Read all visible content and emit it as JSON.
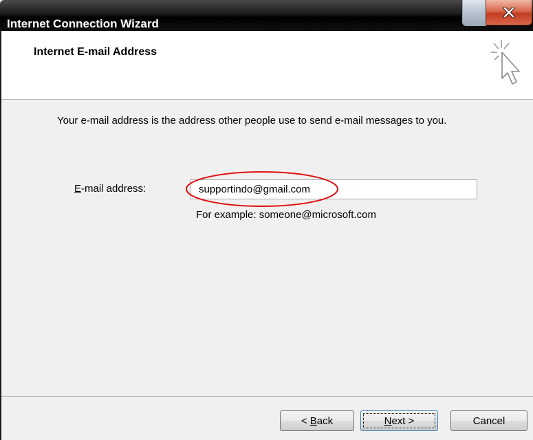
{
  "window": {
    "title": "Internet Connection Wizard"
  },
  "header": {
    "title": "Internet E-mail Address",
    "icon": "wizard-cursor-icon"
  },
  "body": {
    "description": "Your e-mail address is the address other people use to send e-mail messages to you.",
    "email_label_accel": "E",
    "email_label_rest": "-mail address:",
    "email_value": "supportindo@gmail.com",
    "example": "For example: someone@microsoft.com"
  },
  "footer": {
    "back_prefix": "< ",
    "back_accel": "B",
    "back_rest": "ack",
    "next_accel": "N",
    "next_rest": "ext >",
    "cancel_label": "Cancel"
  },
  "colors": {
    "annotation": "#e01010",
    "close_button": "#c23e22"
  }
}
